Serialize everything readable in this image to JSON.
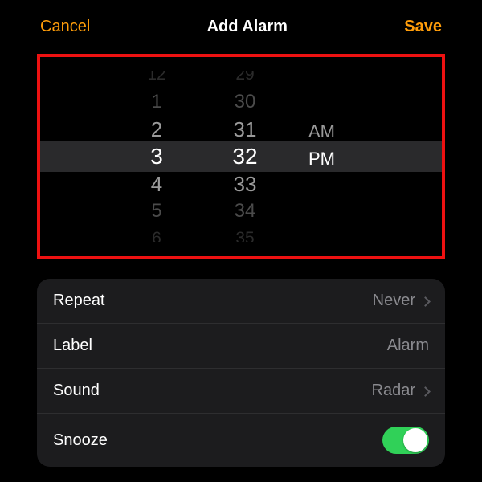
{
  "header": {
    "cancel": "Cancel",
    "title": "Add Alarm",
    "save": "Save"
  },
  "picker": {
    "hour": {
      "far2a": "12",
      "far1a": "1",
      "neara": "2",
      "sel": "3",
      "nearb": "4",
      "far1b": "5",
      "far2b": "6"
    },
    "minute": {
      "far2a": "29",
      "far1a": "30",
      "neara": "31",
      "sel": "32",
      "nearb": "33",
      "far1b": "34",
      "far2b": "35"
    },
    "period": {
      "above": "AM",
      "sel": "PM"
    }
  },
  "settings": {
    "repeat_label": "Repeat",
    "repeat_value": "Never",
    "label_label": "Label",
    "label_value": "Alarm",
    "sound_label": "Sound",
    "sound_value": "Radar",
    "snooze_label": "Snooze",
    "snooze_on": true
  },
  "colors": {
    "accent": "#ff9d0a",
    "toggle_on": "#30d158"
  }
}
